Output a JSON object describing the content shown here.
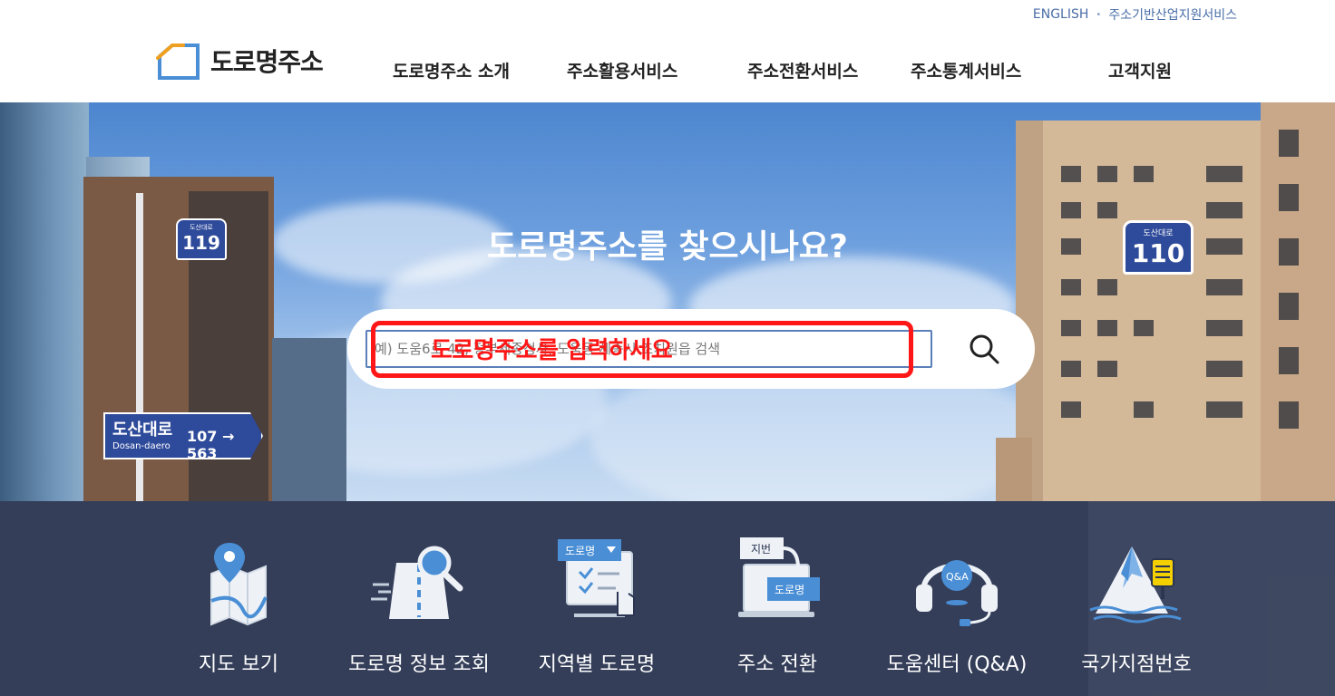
{
  "util": {
    "english": "ENGLISH",
    "support": "주소기반산업지원서비스"
  },
  "logo": {
    "text": "도로명주소"
  },
  "nav": [
    {
      "label": "도로명주소 소개"
    },
    {
      "label": "주소활용서비스"
    },
    {
      "label": "주소전환서비스"
    },
    {
      "label": "주소통계서비스"
    },
    {
      "label": "고객지원"
    }
  ],
  "hero": {
    "title": "도로명주소를 찾으시나요?",
    "search_placeholder": "예) 도움6로 42, 정부세종청사, 도움동 세종시 조치원읍 검색",
    "search_icon": "search-icon",
    "annotation": "도로명주소를 입력하세요"
  },
  "signs": {
    "left_small": {
      "road": "도산대로",
      "num": "119"
    },
    "left_large": {
      "road": "도산대로",
      "roman": "Dosan-daero",
      "range": "107 → 563"
    },
    "right": {
      "road": "도산대로",
      "num": "110"
    }
  },
  "quick_menu": [
    {
      "label": "지도 보기",
      "icon": "map-icon"
    },
    {
      "label": "도로명 정보 조회",
      "icon": "road-search-icon"
    },
    {
      "label": "지역별 도로명",
      "icon": "region-road-icon"
    },
    {
      "label": "주소 전환",
      "icon": "address-convert-icon"
    },
    {
      "label": "도움센터 (Q&A)",
      "icon": "help-center-icon"
    },
    {
      "label": "국가지점번호",
      "icon": "national-point-icon"
    }
  ],
  "icon_tags": {
    "dropdown": "도로명",
    "jibun": "지번",
    "road": "도로명",
    "qa": "Q&A"
  },
  "colors": {
    "accent_blue": "#4a8fd6",
    "nav_text": "#222222",
    "quick_bg": "#2c3652",
    "annotation_red": "#ff1616"
  }
}
